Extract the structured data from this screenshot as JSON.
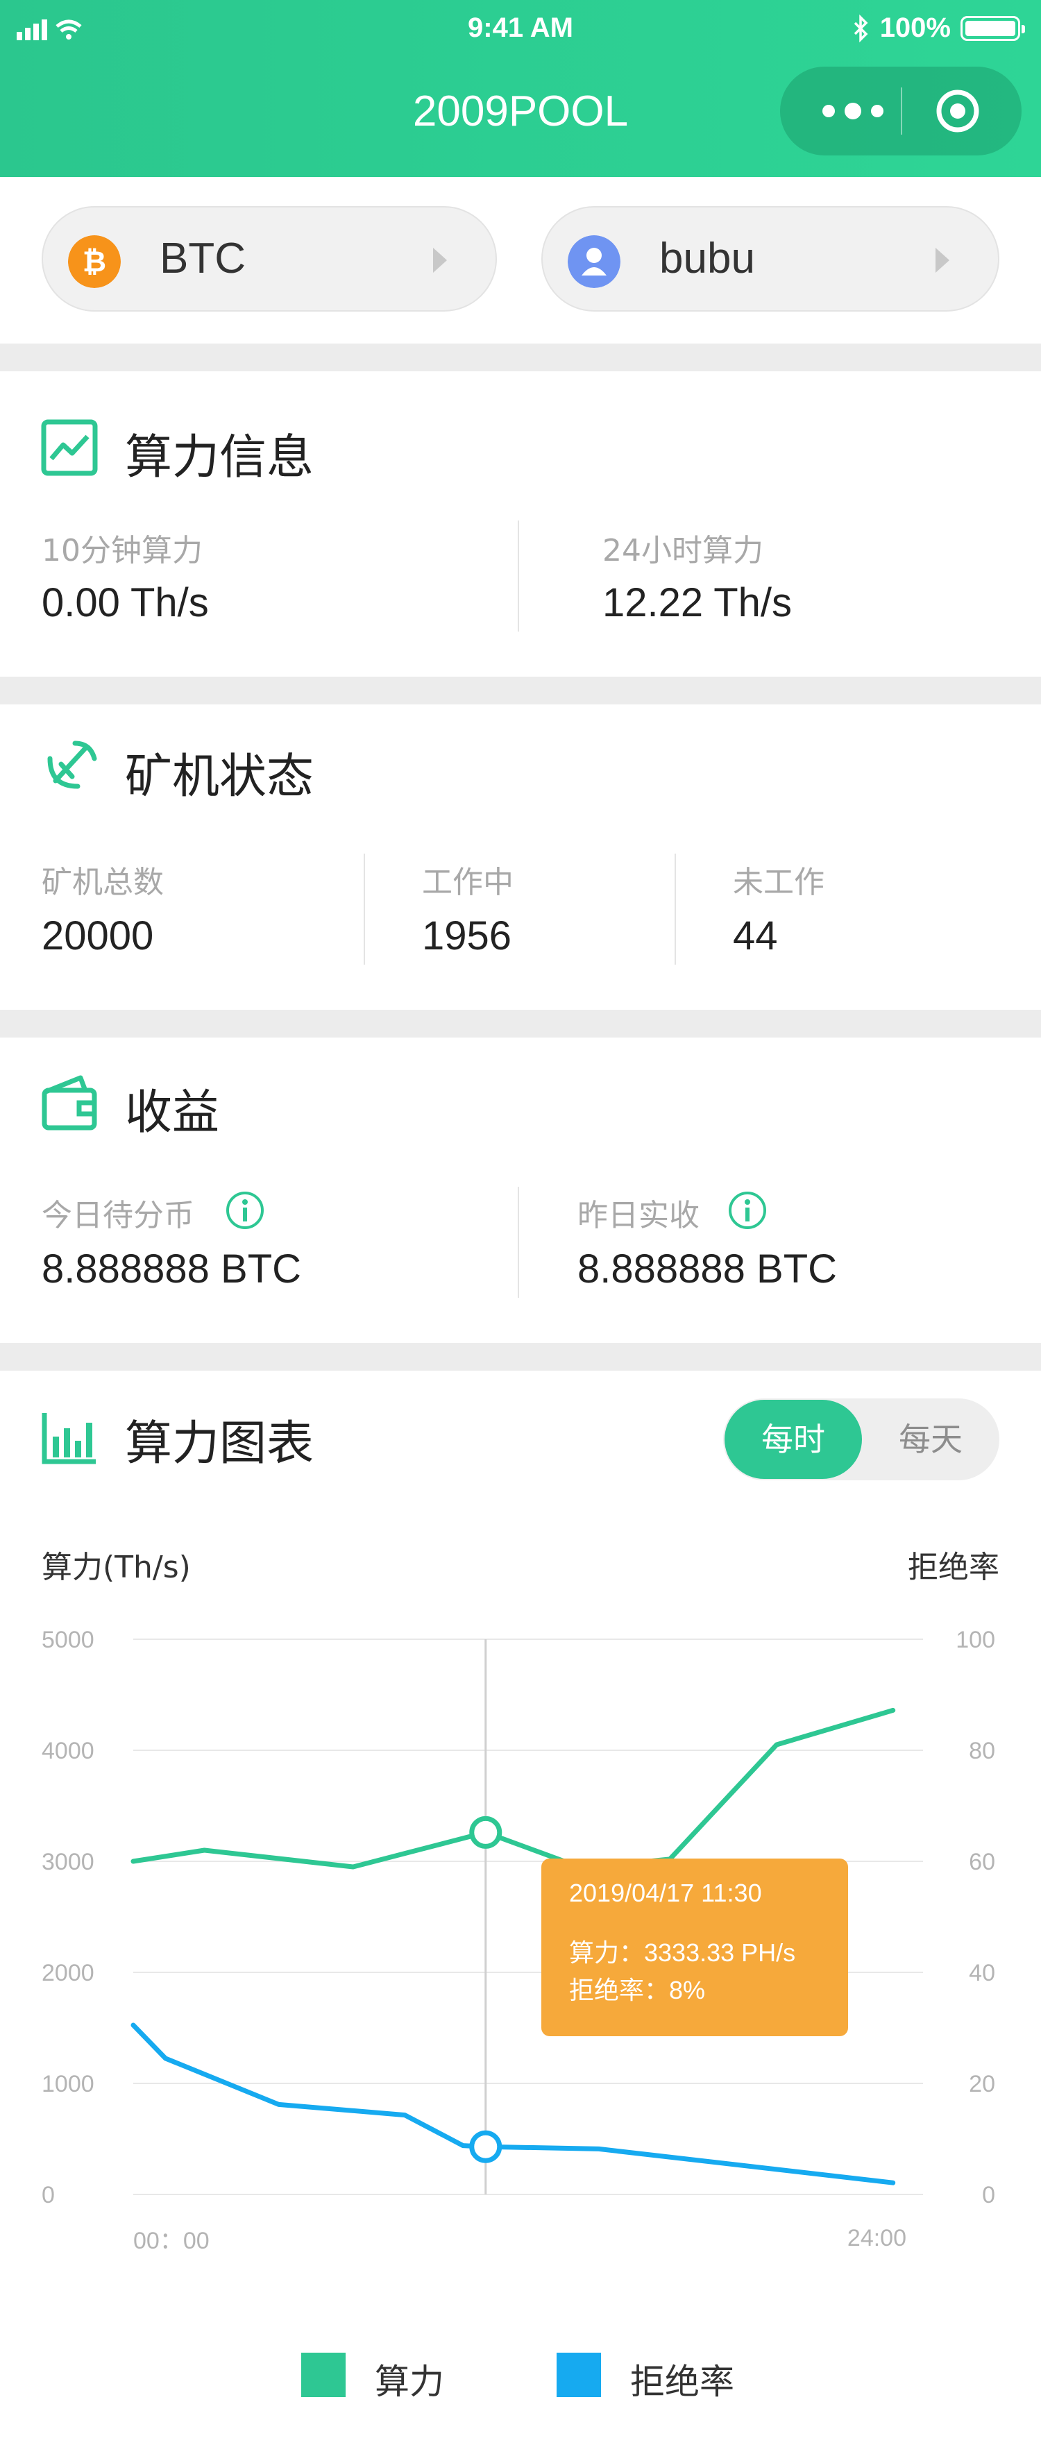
{
  "status_bar": {
    "time": "9:41 AM",
    "battery": "100%"
  },
  "nav": {
    "title": "2009POOL",
    "more_icon": "more-dots-icon",
    "close_icon": "target-circle-icon"
  },
  "selectors": {
    "coin": {
      "label": "BTC",
      "icon": "bitcoin-icon",
      "icon_color": "#f7931a"
    },
    "account": {
      "label": "bubu",
      "icon": "user-icon",
      "icon_color": "#6f94f2"
    }
  },
  "hashrate": {
    "title": "算力信息",
    "items": [
      {
        "label": "10分钟算力",
        "value": "0.00 Th/s"
      },
      {
        "label": "24小时算力",
        "value": "12.22 Th/s"
      }
    ]
  },
  "miners": {
    "title": "矿机状态",
    "items": [
      {
        "label": "矿机总数",
        "value": "20000"
      },
      {
        "label": "工作中",
        "value": "1956"
      },
      {
        "label": "未工作",
        "value": "44"
      }
    ]
  },
  "earnings": {
    "title": "收益",
    "items": [
      {
        "label": "今日待分币",
        "value": "8.888888 BTC"
      },
      {
        "label": "昨日实收",
        "value": "8.888888 BTC"
      }
    ]
  },
  "chart_card": {
    "title": "算力图表",
    "toggle": {
      "hourly": "每时",
      "daily": "每天",
      "selected": "hourly"
    }
  },
  "colors": {
    "accent": "#2ec793",
    "hashrate_line": "#2ec793",
    "reject_line": "#16aaf0",
    "tooltip_bg": "#f6a93b"
  },
  "chart_data": {
    "type": "line",
    "y_left_label": "算力(Th/s)",
    "y_right_label": "拒绝率",
    "y_left_range": [
      0,
      5000
    ],
    "y_right_range": [
      0,
      100
    ],
    "y_left_ticks": [
      "0",
      "1000",
      "2000",
      "3000",
      "4000",
      "5000"
    ],
    "y_right_ticks": [
      "0",
      "20",
      "40",
      "60",
      "80",
      "100"
    ],
    "x_range": [
      0,
      24
    ],
    "x_tick_labels": [
      "00：00",
      "24:00"
    ],
    "grid": true,
    "series": [
      {
        "name": "算力",
        "axis": "left",
        "x": [
          0,
          2.2,
          6.8,
          10.9,
          13.9,
          16.6,
          19.9,
          23.5
        ],
        "y": [
          3000,
          3100,
          2950,
          3260,
          2940,
          3020,
          4050,
          4360
        ]
      },
      {
        "name": "拒绝率",
        "axis": "right",
        "x": [
          0,
          1,
          4.5,
          8.4,
          10.2,
          10.9,
          14.4,
          23.5
        ],
        "y": [
          30.5,
          24.5,
          16.2,
          14.3,
          8.8,
          8.6,
          8.2,
          2.1
        ]
      }
    ],
    "crosshair_x": 10.9,
    "tooltip": {
      "time": "2019/04/17  11:30",
      "line1": "算力：3333.33 PH/s",
      "line2": "拒绝率：8%"
    },
    "legend": [
      "算力",
      "拒绝率"
    ],
    "legend_position": "bottom"
  }
}
